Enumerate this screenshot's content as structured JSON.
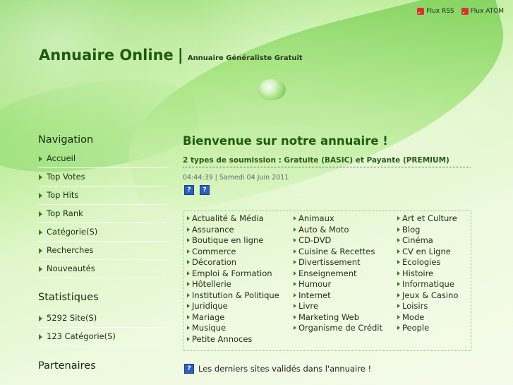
{
  "topbar": {
    "rss_label": "Flux RSS",
    "atom_label": "Flux ATOM"
  },
  "header": {
    "site_name": "Annuaire Online",
    "separator": "|",
    "tagline": "Annuaire Généraliste Gratuit"
  },
  "sidebar": {
    "nav_title": "Navigation",
    "nav_items": [
      "Accueil",
      "Top Votes",
      "Top Hits",
      "Top Rank",
      "Catégorie(S)",
      "Recherches",
      "Nouveautés"
    ],
    "stats_title": "Statistiques",
    "stats_items": [
      "5292 Site(S)",
      "123 Catégorie(S)"
    ],
    "partners_title": "Partenaires"
  },
  "main": {
    "welcome": "Bienvenue sur notre annuaire !",
    "subtitle": "2 types de soumission : Gratuite (BASIC) et Payante (PREMIUM)",
    "datetime": "04:44:39 | Samedi 04 Juin 2011",
    "categories": {
      "col1": [
        "Actualité & Média",
        "Assurance",
        "Boutique en ligne",
        "Commerce",
        "Décoration",
        "Emploi & Formation",
        "Hôtellerie",
        "Institution & Politique",
        "Juridique",
        "Mariage",
        "Musique",
        "Petite Annoces"
      ],
      "col2": [
        "Animaux",
        "Auto & Moto",
        "CD-DVD",
        "Cuisine & Recettes",
        "Divertissement",
        "Enseignement",
        "Humour",
        "Internet",
        "Livre",
        "Marketing Web",
        "Organisme de Crédit"
      ],
      "col3": [
        "Art et Culture",
        "Blog",
        "Cinéma",
        "CV en Ligne",
        "Ecologies",
        "Histoire",
        "Informatique",
        "Jeux & Casino",
        "Loisirs",
        "Mode",
        "People"
      ]
    },
    "latest": "Les derniers sites validés dans l'annuaire !"
  }
}
